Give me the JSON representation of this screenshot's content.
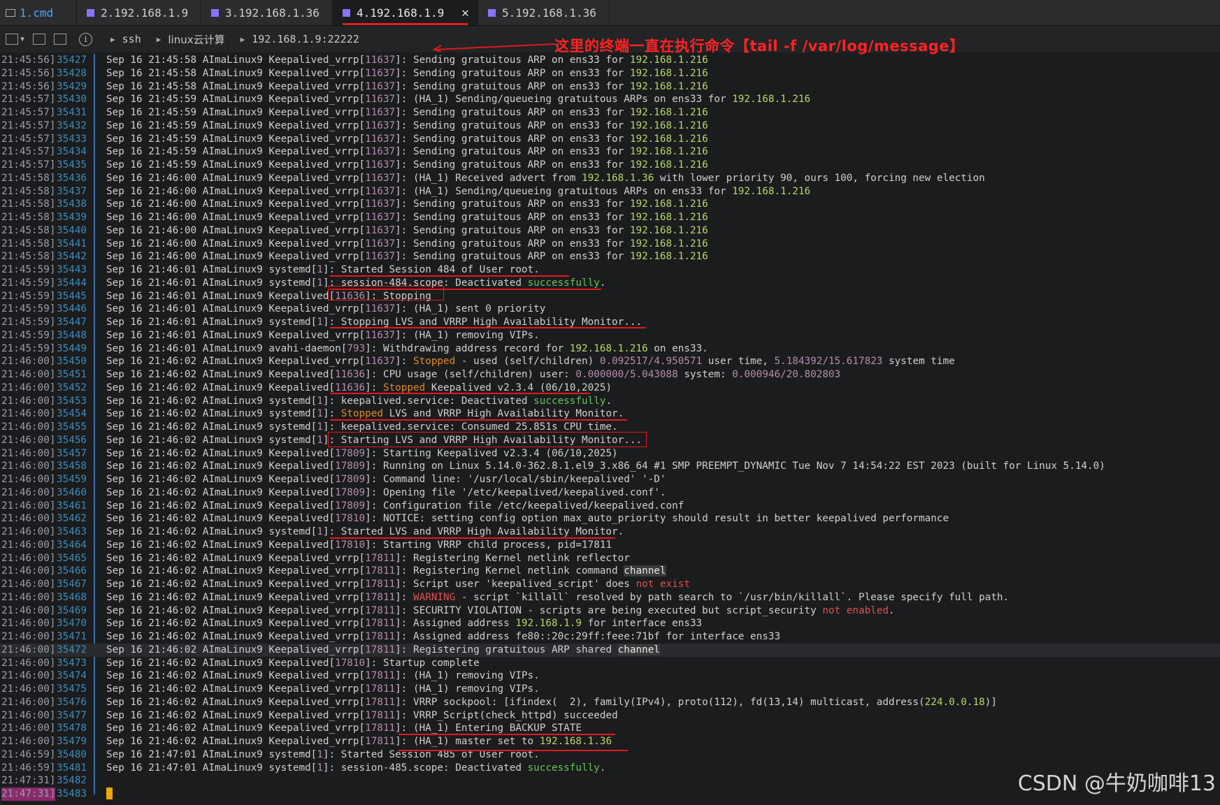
{
  "tabs": [
    {
      "label": "1.cmd"
    },
    {
      "label": "2.192.168.1.9"
    },
    {
      "label": "3.192.168.1.36"
    },
    {
      "label": "4.192.168.1.9"
    },
    {
      "label": "5.192.168.1.36"
    }
  ],
  "toolbar": {
    "crumb1": "ssh",
    "crumb2": "linux云计算",
    "crumb3": "192.168.1.9:22222",
    "info_symbol": "i"
  },
  "annotation": "这里的终端一直在执行命令【tail -f /var/log/message】",
  "watermark": "CSDN @牛奶咖啡13",
  "log": [
    {
      "ts": "21:45:56]",
      "no": "35427",
      "text": "Sep 16 21:45:58 AImaLinux9 Keepalived_vrrp[11637]: Sending gratuitous ARP on ens33 for 192.168.1.216"
    },
    {
      "ts": "21:45:56]",
      "no": "35428",
      "text": "Sep 16 21:45:58 AImaLinux9 Keepalived_vrrp[11637]: Sending gratuitous ARP on ens33 for 192.168.1.216"
    },
    {
      "ts": "21:45:56]",
      "no": "35429",
      "text": "Sep 16 21:45:58 AImaLinux9 Keepalived_vrrp[11637]: Sending gratuitous ARP on ens33 for 192.168.1.216"
    },
    {
      "ts": "21:45:57]",
      "no": "35430",
      "text": "Sep 16 21:45:59 AImaLinux9 Keepalived_vrrp[11637]: (HA_1) Sending/queueing gratuitous ARPs on ens33 for 192.168.1.216"
    },
    {
      "ts": "21:45:57]",
      "no": "35431",
      "text": "Sep 16 21:45:59 AImaLinux9 Keepalived_vrrp[11637]: Sending gratuitous ARP on ens33 for 192.168.1.216"
    },
    {
      "ts": "21:45:57]",
      "no": "35432",
      "text": "Sep 16 21:45:59 AImaLinux9 Keepalived_vrrp[11637]: Sending gratuitous ARP on ens33 for 192.168.1.216"
    },
    {
      "ts": "21:45:57]",
      "no": "35433",
      "text": "Sep 16 21:45:59 AImaLinux9 Keepalived_vrrp[11637]: Sending gratuitous ARP on ens33 for 192.168.1.216"
    },
    {
      "ts": "21:45:57]",
      "no": "35434",
      "text": "Sep 16 21:45:59 AImaLinux9 Keepalived_vrrp[11637]: Sending gratuitous ARP on ens33 for 192.168.1.216"
    },
    {
      "ts": "21:45:57]",
      "no": "35435",
      "text": "Sep 16 21:45:59 AImaLinux9 Keepalived_vrrp[11637]: Sending gratuitous ARP on ens33 for 192.168.1.216"
    },
    {
      "ts": "21:45:58]",
      "no": "35436",
      "text": "Sep 16 21:46:00 AImaLinux9 Keepalived_vrrp[11637]: (HA_1) Received advert from 192.168.1.36 with lower priority 90, ours 100, forcing new election"
    },
    {
      "ts": "21:45:58]",
      "no": "35437",
      "text": "Sep 16 21:46:00 AImaLinux9 Keepalived_vrrp[11637]: (HA_1) Sending/queueing gratuitous ARPs on ens33 for 192.168.1.216"
    },
    {
      "ts": "21:45:58]",
      "no": "35438",
      "text": "Sep 16 21:46:00 AImaLinux9 Keepalived_vrrp[11637]: Sending gratuitous ARP on ens33 for 192.168.1.216"
    },
    {
      "ts": "21:45:58]",
      "no": "35439",
      "text": "Sep 16 21:46:00 AImaLinux9 Keepalived_vrrp[11637]: Sending gratuitous ARP on ens33 for 192.168.1.216"
    },
    {
      "ts": "21:45:58]",
      "no": "35440",
      "text": "Sep 16 21:46:00 AImaLinux9 Keepalived_vrrp[11637]: Sending gratuitous ARP on ens33 for 192.168.1.216"
    },
    {
      "ts": "21:45:58]",
      "no": "35441",
      "text": "Sep 16 21:46:00 AImaLinux9 Keepalived_vrrp[11637]: Sending gratuitous ARP on ens33 for 192.168.1.216"
    },
    {
      "ts": "21:45:58]",
      "no": "35442",
      "text": "Sep 16 21:46:00 AImaLinux9 Keepalived_vrrp[11637]: Sending gratuitous ARP on ens33 for 192.168.1.216"
    },
    {
      "ts": "21:45:59]",
      "no": "35443",
      "text": "Sep 16 21:46:01 AImaLinux9 systemd[1]: Started Session 484 of User root."
    },
    {
      "ts": "21:45:59]",
      "no": "35444",
      "text": "Sep 16 21:46:01 AImaLinux9 systemd[1]: session-484.scope: Deactivated successfully."
    },
    {
      "ts": "21:45:59]",
      "no": "35445",
      "text": "Sep 16 21:46:01 AImaLinux9 Keepalived[11636]: Stopping"
    },
    {
      "ts": "21:45:59]",
      "no": "35446",
      "text": "Sep 16 21:46:01 AImaLinux9 Keepalived_vrrp[11637]: (HA_1) sent 0 priority"
    },
    {
      "ts": "21:45:59]",
      "no": "35447",
      "text": "Sep 16 21:46:01 AImaLinux9 systemd[1]: Stopping LVS and VRRP High Availability Monitor..."
    },
    {
      "ts": "21:45:59]",
      "no": "35448",
      "text": "Sep 16 21:46:01 AImaLinux9 Keepalived_vrrp[11637]: (HA_1) removing VIPs."
    },
    {
      "ts": "21:45:59]",
      "no": "35449",
      "text": "Sep 16 21:46:01 AImaLinux9 avahi-daemon[793]: Withdrawing address record for 192.168.1.216 on ens33."
    },
    {
      "ts": "21:46:00]",
      "no": "35450",
      "text": "Sep 16 21:46:02 AImaLinux9 Keepalived_vrrp[11637]: Stopped - used (self/children) 0.092517/4.950571 user time, 5.184392/15.617823 system time"
    },
    {
      "ts": "21:46:00]",
      "no": "35451",
      "text": "Sep 16 21:46:02 AImaLinux9 Keepalived[11636]: CPU usage (self/children) user: 0.000000/5.043088 system: 0.000946/20.802803"
    },
    {
      "ts": "21:46:00]",
      "no": "35452",
      "text": "Sep 16 21:46:02 AImaLinux9 Keepalived[11636]: Stopped Keepalived v2.3.4 (06/10,2025)"
    },
    {
      "ts": "21:46:00]",
      "no": "35453",
      "text": "Sep 16 21:46:02 AImaLinux9 systemd[1]: keepalived.service: Deactivated successfully."
    },
    {
      "ts": "21:46:00]",
      "no": "35454",
      "text": "Sep 16 21:46:02 AImaLinux9 systemd[1]: Stopped LVS and VRRP High Availability Monitor."
    },
    {
      "ts": "21:46:00]",
      "no": "35455",
      "text": "Sep 16 21:46:02 AImaLinux9 systemd[1]: keepalived.service: Consumed 25.851s CPU time."
    },
    {
      "ts": "21:46:00]",
      "no": "35456",
      "text": "Sep 16 21:46:02 AImaLinux9 systemd[1]: Starting LVS and VRRP High Availability Monitor..."
    },
    {
      "ts": "21:46:00]",
      "no": "35457",
      "text": "Sep 16 21:46:02 AImaLinux9 Keepalived[17809]: Starting Keepalived v2.3.4 (06/10,2025)"
    },
    {
      "ts": "21:46:00]",
      "no": "35458",
      "text": "Sep 16 21:46:02 AImaLinux9 Keepalived[17809]: Running on Linux 5.14.0-362.8.1.el9_3.x86_64 #1 SMP PREEMPT_DYNAMIC Tue Nov 7 14:54:22 EST 2023 (built for Linux 5.14.0)"
    },
    {
      "ts": "21:46:00]",
      "no": "35459",
      "text": "Sep 16 21:46:02 AImaLinux9 Keepalived[17809]: Command line: '/usr/local/sbin/keepalived' '-D'"
    },
    {
      "ts": "21:46:00]",
      "no": "35460",
      "text": "Sep 16 21:46:02 AImaLinux9 Keepalived[17809]: Opening file '/etc/keepalived/keepalived.conf'."
    },
    {
      "ts": "21:46:00]",
      "no": "35461",
      "text": "Sep 16 21:46:02 AImaLinux9 Keepalived[17809]: Configuration file /etc/keepalived/keepalived.conf"
    },
    {
      "ts": "21:46:00]",
      "no": "35462",
      "text": "Sep 16 21:46:02 AImaLinux9 Keepalived[17810]: NOTICE: setting config option max_auto_priority should result in better keepalived performance"
    },
    {
      "ts": "21:46:00]",
      "no": "35463",
      "text": "Sep 16 21:46:02 AImaLinux9 systemd[1]: Started LVS and VRRP High Availability Monitor."
    },
    {
      "ts": "21:46:00]",
      "no": "35464",
      "text": "Sep 16 21:46:02 AImaLinux9 Keepalived[17810]: Starting VRRP child process, pid=17811"
    },
    {
      "ts": "21:46:00]",
      "no": "35465",
      "text": "Sep 16 21:46:02 AImaLinux9 Keepalived_vrrp[17811]: Registering Kernel netlink reflector"
    },
    {
      "ts": "21:46:00]",
      "no": "35466",
      "text": "Sep 16 21:46:02 AImaLinux9 Keepalived_vrrp[17811]: Registering Kernel netlink command channel"
    },
    {
      "ts": "21:46:00]",
      "no": "35467",
      "text": "Sep 16 21:46:02 AImaLinux9 Keepalived_vrrp[17811]: Script user 'keepalived_script' does not exist"
    },
    {
      "ts": "21:46:00]",
      "no": "35468",
      "text": "Sep 16 21:46:02 AImaLinux9 Keepalived_vrrp[17811]: WARNING - script `killall` resolved by path search to `/usr/bin/killall`. Please specify full path."
    },
    {
      "ts": "21:46:00]",
      "no": "35469",
      "text": "Sep 16 21:46:02 AImaLinux9 Keepalived_vrrp[17811]: SECURITY VIOLATION - scripts are being executed but script_security not enabled."
    },
    {
      "ts": "21:46:00]",
      "no": "35470",
      "text": "Sep 16 21:46:02 AImaLinux9 Keepalived_vrrp[17811]: Assigned address 192.168.1.9 for interface ens33"
    },
    {
      "ts": "21:46:00]",
      "no": "35471",
      "text": "Sep 16 21:46:02 AImaLinux9 Keepalived_vrrp[17811]: Assigned address fe80::20c:29ff:feee:71bf for interface ens33"
    },
    {
      "ts": "21:46:00]",
      "no": "35472",
      "text": "Sep 16 21:46:02 AImaLinux9 Keepalived_vrrp[17811]: Registering gratuitous ARP shared channel"
    },
    {
      "ts": "21:46:00]",
      "no": "35473",
      "text": "Sep 16 21:46:02 AImaLinux9 Keepalived[17810]: Startup complete"
    },
    {
      "ts": "21:46:00]",
      "no": "35474",
      "text": "Sep 16 21:46:02 AImaLinux9 Keepalived_vrrp[17811]: (HA_1) removing VIPs."
    },
    {
      "ts": "21:46:00]",
      "no": "35475",
      "text": "Sep 16 21:46:02 AImaLinux9 Keepalived_vrrp[17811]: (HA_1) removing VIPs."
    },
    {
      "ts": "21:46:00]",
      "no": "35476",
      "text": "Sep 16 21:46:02 AImaLinux9 Keepalived_vrrp[17811]: VRRP sockpool: [ifindex(  2), family(IPv4), proto(112), fd(13,14) multicast, address(224.0.0.18)]"
    },
    {
      "ts": "21:46:00]",
      "no": "35477",
      "text": "Sep 16 21:46:02 AImaLinux9 Keepalived_vrrp[17811]: VRRP_Script(check_httpd) succeeded"
    },
    {
      "ts": "21:46:00]",
      "no": "35478",
      "text": "Sep 16 21:46:02 AImaLinux9 Keepalived_vrrp[17811]: (HA_1) Entering BACKUP STATE"
    },
    {
      "ts": "21:46:00]",
      "no": "35479",
      "text": "Sep 16 21:46:02 AImaLinux9 Keepalived_vrrp[17811]: (HA_1) master set to 192.168.1.36"
    },
    {
      "ts": "21:46:59]",
      "no": "35480",
      "text": "Sep 16 21:47:01 AImaLinux9 systemd[1]: Started Session 485 of User root."
    },
    {
      "ts": "21:46:59]",
      "no": "35481",
      "text": "Sep 16 21:47:01 AImaLinux9 systemd[1]: session-485.scope: Deactivated successfully."
    },
    {
      "ts": "21:47:31]",
      "no": "35482",
      "text": ""
    },
    {
      "ts": "21:47:31]",
      "no": "35483",
      "text": "└"
    }
  ]
}
